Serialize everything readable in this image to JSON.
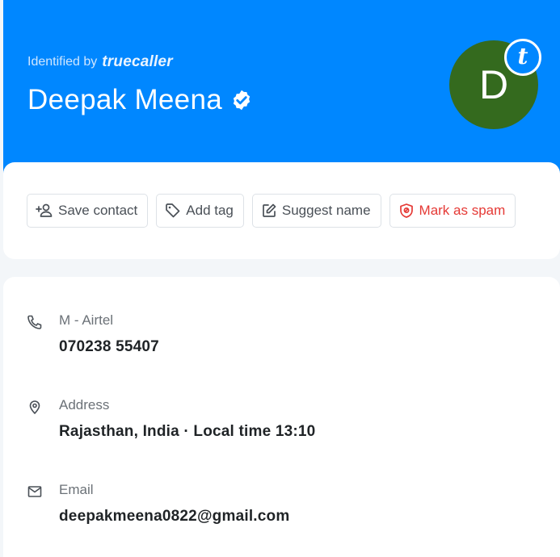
{
  "header": {
    "identified_by": "Identified by",
    "brand": "truecaller",
    "name": "Deepak Meena",
    "avatar_initial": "D",
    "badge_letter": "t",
    "colors": {
      "header_bg": "#0087ff",
      "avatar_bg": "#346a1e"
    }
  },
  "actions": [
    {
      "label": "Save contact",
      "icon": "add-person-icon"
    },
    {
      "label": "Add tag",
      "icon": "tag-icon"
    },
    {
      "label": "Suggest name",
      "icon": "edit-icon"
    },
    {
      "label": "Mark as spam",
      "icon": "shield-icon",
      "color": "#e53935"
    }
  ],
  "details": {
    "phone": {
      "label": "M - Airtel",
      "value": "070238 55407",
      "icon": "phone-icon"
    },
    "address": {
      "label": "Address",
      "value": "Rajasthan, India · Local time 13:10",
      "icon": "location-pin-icon"
    },
    "email": {
      "label": "Email",
      "value": "deepakmeena0822@gmail.com",
      "icon": "mail-icon"
    }
  }
}
